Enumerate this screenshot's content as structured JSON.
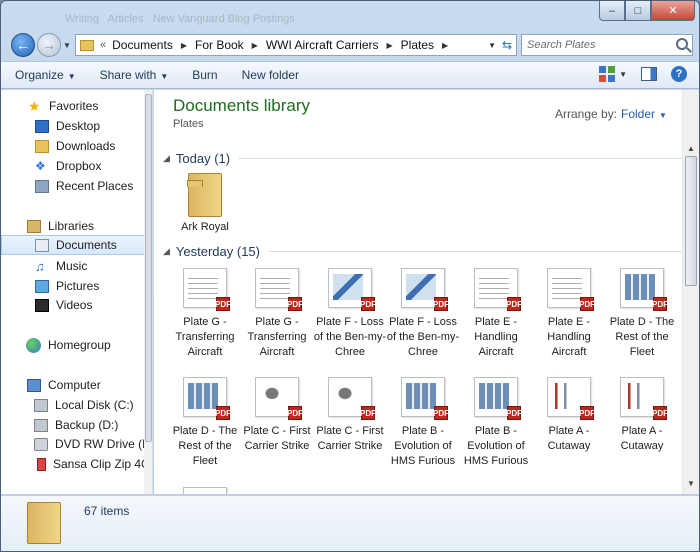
{
  "titlebar": {
    "ghost_breadcrumb": [
      "Writing",
      "Articles",
      "New Vanguard Blog Postings"
    ]
  },
  "address": {
    "crumbs": [
      "Documents",
      "For Book",
      "WWI Aircraft Carriers",
      "Plates"
    ],
    "chevron": "«"
  },
  "search": {
    "placeholder": "Search Plates"
  },
  "toolbar": {
    "organize": "Organize",
    "share_with": "Share with",
    "burn": "Burn",
    "new_folder": "New folder"
  },
  "nav": {
    "favorites": "Favorites",
    "desktop": "Desktop",
    "downloads": "Downloads",
    "dropbox": "Dropbox",
    "recent_places": "Recent Places",
    "libraries": "Libraries",
    "documents": "Documents",
    "music": "Music",
    "pictures": "Pictures",
    "videos": "Videos",
    "homegroup": "Homegroup",
    "computer": "Computer",
    "local_disk": "Local Disk (C:)",
    "backup": "Backup (D:)",
    "dvd": "DVD RW Drive (E",
    "sansa": "Sansa Clip Zip 4G"
  },
  "library": {
    "title": "Documents library",
    "subtitle": "Plates",
    "arrange_label": "Arrange by:",
    "arrange_value": "Folder"
  },
  "groups": {
    "today": "Today (1)",
    "yesterday": "Yesterday (15)"
  },
  "today_items": [
    {
      "caption": "Ark Royal"
    }
  ],
  "yesterday_items": [
    {
      "caption": "Plate G - Transferring Aircraft",
      "icon": "drawing"
    },
    {
      "caption": "Plate G - Transferring Aircraft",
      "icon": "drawing"
    },
    {
      "caption": "Plate F - Loss of the Ben-my-Chree",
      "icon": "map"
    },
    {
      "caption": "Plate F - Loss of the Ben-my-Chree",
      "icon": "map"
    },
    {
      "caption": "Plate E - Handling Aircraft",
      "icon": "drawing"
    },
    {
      "caption": "Plate E - Handling Aircraft",
      "icon": "drawing"
    },
    {
      "caption": "Plate D - The Rest of the Fleet",
      "icon": "grid"
    },
    {
      "caption": "Plate D - The Rest of the Fleet",
      "icon": "grid"
    },
    {
      "caption": "Plate C - First Carrier Strike",
      "icon": "plane"
    },
    {
      "caption": "Plate C - First Carrier Strike",
      "icon": "plane"
    },
    {
      "caption": "Plate B - Evolution of HMS Furious",
      "icon": "grid"
    },
    {
      "caption": "Plate B - Evolution of HMS Furious",
      "icon": "grid"
    },
    {
      "caption": "Plate A - Cutaway",
      "icon": "cutaway"
    },
    {
      "caption": "Plate A - Cutaway",
      "icon": "cutaway"
    }
  ],
  "pdf_badge": "PDF",
  "status": {
    "count": "67 items"
  }
}
